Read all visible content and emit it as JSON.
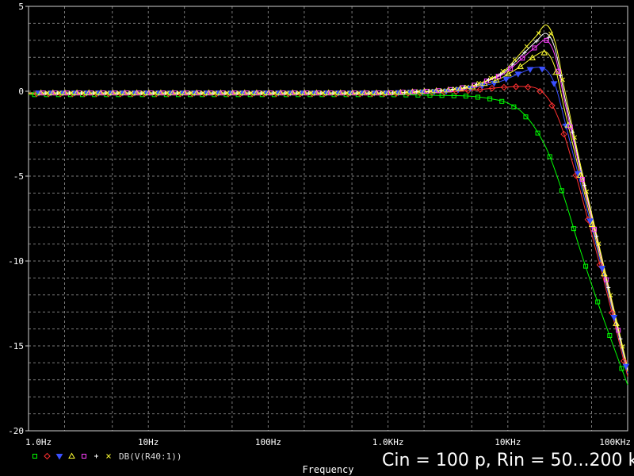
{
  "caption": "Cin = 100 p, Rin = 50...200 k",
  "chart_data": {
    "type": "line",
    "x_scale": "log",
    "xlim": [
      1,
      100000
    ],
    "ylim": [
      -20,
      5
    ],
    "xlabel": "Frequency",
    "ylabel": "",
    "grid": true,
    "x_ticks": [
      {
        "value": 1,
        "label": "1.0Hz"
      },
      {
        "value": 10,
        "label": "10Hz"
      },
      {
        "value": 100,
        "label": "100Hz"
      },
      {
        "value": 1000,
        "label": "1.0KHz"
      },
      {
        "value": 10000,
        "label": "10KHz"
      },
      {
        "value": 100000,
        "label": "100KHz"
      }
    ],
    "y_ticks": [
      {
        "value": 5,
        "label": "5"
      },
      {
        "value": 0,
        "label": "0"
      },
      {
        "value": -5,
        "label": "-5"
      },
      {
        "value": -10,
        "label": "-10"
      },
      {
        "value": -15,
        "label": "-15"
      },
      {
        "value": -20,
        "label": "-20"
      }
    ],
    "legend": {
      "placement": "bottom-left",
      "expression": "DB(V(R40:1))"
    },
    "series": [
      {
        "color": "#00ff00",
        "marker": "square",
        "x": [
          1,
          100,
          1000,
          3000,
          5000,
          8000,
          10000,
          13000,
          17000,
          22000,
          30000,
          40000,
          60000,
          100000
        ],
        "y": [
          -0.2,
          -0.2,
          -0.2,
          -0.25,
          -0.3,
          -0.5,
          -0.7,
          -1.2,
          -2.2,
          -3.7,
          -6.4,
          -9.3,
          -13.0,
          -17.3
        ]
      },
      {
        "color": "#ff3030",
        "marker": "diamond",
        "x": [
          1,
          100,
          1000,
          3000,
          5000,
          8000,
          10000,
          13000,
          17000,
          21000,
          25000,
          30000,
          40000,
          60000,
          100000
        ],
        "y": [
          -0.15,
          -0.15,
          -0.15,
          -0.05,
          0.05,
          0.2,
          0.25,
          0.28,
          0.2,
          -0.3,
          -1.2,
          -2.7,
          -5.8,
          -10.5,
          -16.8
        ]
      },
      {
        "color": "#3a50ff",
        "marker": "triangle-down",
        "x": [
          1,
          100,
          1000,
          3000,
          5000,
          8000,
          10000,
          13000,
          17000,
          21000,
          25000,
          30000,
          40000,
          60000,
          100000
        ],
        "y": [
          -0.1,
          -0.1,
          -0.1,
          0.0,
          0.2,
          0.5,
          0.75,
          1.1,
          1.4,
          1.25,
          0.3,
          -1.8,
          -5.3,
          -10.2,
          -16.6
        ]
      },
      {
        "color": "#ffff33",
        "marker": "triangle",
        "x": [
          1,
          100,
          1000,
          3000,
          5000,
          8000,
          10000,
          13000,
          17000,
          21000,
          25000,
          30000,
          40000,
          60000,
          100000
        ],
        "y": [
          -0.1,
          -0.1,
          -0.1,
          0.05,
          0.25,
          0.65,
          1.0,
          1.5,
          2.1,
          2.3,
          1.3,
          -1.2,
          -4.9,
          -10.0,
          -16.5
        ]
      },
      {
        "color": "#ff40ff",
        "marker": "square-open",
        "x": [
          1,
          100,
          1000,
          3000,
          5000,
          8000,
          10000,
          13000,
          17000,
          21000,
          25000,
          30000,
          40000,
          60000,
          100000
        ],
        "y": [
          -0.1,
          -0.1,
          -0.1,
          0.05,
          0.3,
          0.8,
          1.2,
          1.9,
          2.6,
          3.0,
          2.0,
          -0.7,
          -4.6,
          -9.8,
          -16.4
        ]
      },
      {
        "color": "#ffffff",
        "marker": "plus",
        "x": [
          1,
          100,
          1000,
          3000,
          5000,
          8000,
          10000,
          13000,
          17000,
          21000,
          25000,
          30000,
          40000,
          60000,
          100000
        ],
        "y": [
          -0.1,
          -0.1,
          -0.1,
          0.05,
          0.3,
          0.85,
          1.3,
          2.1,
          2.9,
          3.4,
          2.4,
          -0.4,
          -4.4,
          -9.7,
          -16.4
        ]
      },
      {
        "color": "#ffff33",
        "marker": "cross",
        "x": [
          1,
          100,
          1000,
          3000,
          5000,
          8000,
          10000,
          13000,
          17000,
          21000,
          25000,
          30000,
          40000,
          60000,
          100000
        ],
        "y": [
          -0.1,
          -0.1,
          -0.1,
          0.05,
          0.3,
          0.9,
          1.4,
          2.3,
          3.2,
          3.9,
          2.8,
          0.0,
          -4.2,
          -9.6,
          -16.3
        ]
      }
    ]
  }
}
